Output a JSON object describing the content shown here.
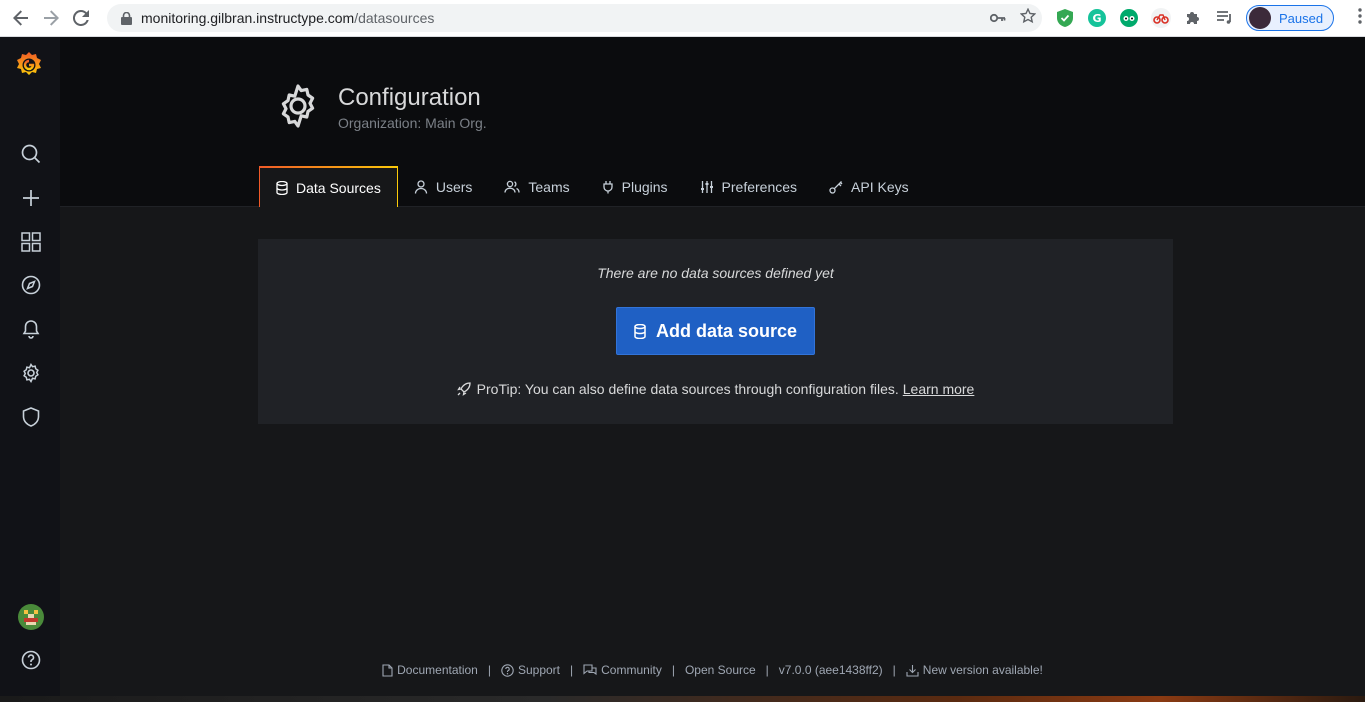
{
  "browser": {
    "url_host": "monitoring.gilbran.instructype.com",
    "url_path": "/datasources",
    "profile_label": "Paused"
  },
  "page": {
    "title": "Configuration",
    "subtitle": "Organization: Main Org."
  },
  "tabs": [
    {
      "label": "Data Sources",
      "icon": "database-icon",
      "active": true
    },
    {
      "label": "Users",
      "icon": "user-icon",
      "active": false
    },
    {
      "label": "Teams",
      "icon": "users-icon",
      "active": false
    },
    {
      "label": "Plugins",
      "icon": "plug-icon",
      "active": false
    },
    {
      "label": "Preferences",
      "icon": "sliders-icon",
      "active": false
    },
    {
      "label": "API Keys",
      "icon": "key-icon",
      "active": false
    }
  ],
  "empty_state": {
    "title": "There are no data sources defined yet",
    "button_label": "Add data source",
    "protip": "ProTip: You can also define data sources through configuration files.",
    "protip_link": "Learn more"
  },
  "footer": {
    "documentation": "Documentation",
    "support": "Support",
    "community": "Community",
    "open_source": "Open Source",
    "version": "v7.0.0 (aee1438ff2)",
    "new_version": "New version available!",
    "separator": "|"
  },
  "colors": {
    "primary_button": "#1f60c4",
    "tab_gradient_start": "#f05a28",
    "tab_gradient_end": "#fbca0a",
    "background": "#161719",
    "sidebar": "#111217"
  }
}
